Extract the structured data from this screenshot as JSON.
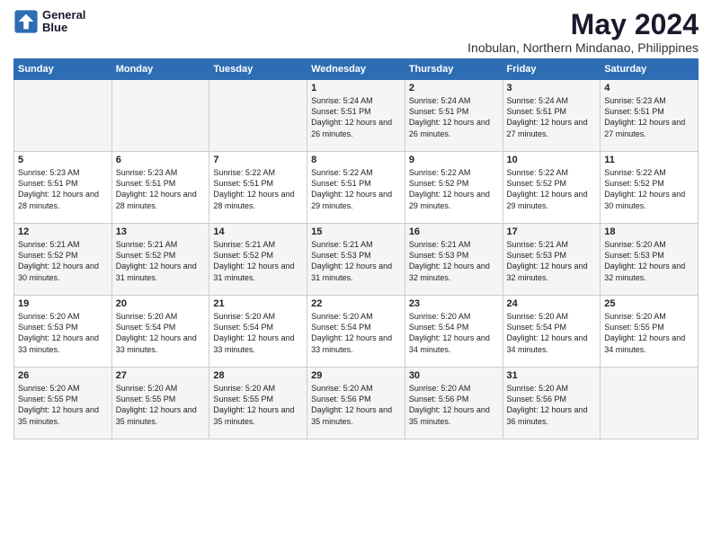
{
  "header": {
    "logo_line1": "General",
    "logo_line2": "Blue",
    "month_year": "May 2024",
    "location": "Inobulan, Northern Mindanao, Philippines"
  },
  "weekdays": [
    "Sunday",
    "Monday",
    "Tuesday",
    "Wednesday",
    "Thursday",
    "Friday",
    "Saturday"
  ],
  "weeks": [
    [
      {
        "day": "",
        "info": ""
      },
      {
        "day": "",
        "info": ""
      },
      {
        "day": "",
        "info": ""
      },
      {
        "day": "1",
        "info": "Sunrise: 5:24 AM\nSunset: 5:51 PM\nDaylight: 12 hours\nand 26 minutes."
      },
      {
        "day": "2",
        "info": "Sunrise: 5:24 AM\nSunset: 5:51 PM\nDaylight: 12 hours\nand 26 minutes."
      },
      {
        "day": "3",
        "info": "Sunrise: 5:24 AM\nSunset: 5:51 PM\nDaylight: 12 hours\nand 27 minutes."
      },
      {
        "day": "4",
        "info": "Sunrise: 5:23 AM\nSunset: 5:51 PM\nDaylight: 12 hours\nand 27 minutes."
      }
    ],
    [
      {
        "day": "5",
        "info": "Sunrise: 5:23 AM\nSunset: 5:51 PM\nDaylight: 12 hours\nand 28 minutes."
      },
      {
        "day": "6",
        "info": "Sunrise: 5:23 AM\nSunset: 5:51 PM\nDaylight: 12 hours\nand 28 minutes."
      },
      {
        "day": "7",
        "info": "Sunrise: 5:22 AM\nSunset: 5:51 PM\nDaylight: 12 hours\nand 28 minutes."
      },
      {
        "day": "8",
        "info": "Sunrise: 5:22 AM\nSunset: 5:51 PM\nDaylight: 12 hours\nand 29 minutes."
      },
      {
        "day": "9",
        "info": "Sunrise: 5:22 AM\nSunset: 5:52 PM\nDaylight: 12 hours\nand 29 minutes."
      },
      {
        "day": "10",
        "info": "Sunrise: 5:22 AM\nSunset: 5:52 PM\nDaylight: 12 hours\nand 29 minutes."
      },
      {
        "day": "11",
        "info": "Sunrise: 5:22 AM\nSunset: 5:52 PM\nDaylight: 12 hours\nand 30 minutes."
      }
    ],
    [
      {
        "day": "12",
        "info": "Sunrise: 5:21 AM\nSunset: 5:52 PM\nDaylight: 12 hours\nand 30 minutes."
      },
      {
        "day": "13",
        "info": "Sunrise: 5:21 AM\nSunset: 5:52 PM\nDaylight: 12 hours\nand 31 minutes."
      },
      {
        "day": "14",
        "info": "Sunrise: 5:21 AM\nSunset: 5:52 PM\nDaylight: 12 hours\nand 31 minutes."
      },
      {
        "day": "15",
        "info": "Sunrise: 5:21 AM\nSunset: 5:53 PM\nDaylight: 12 hours\nand 31 minutes."
      },
      {
        "day": "16",
        "info": "Sunrise: 5:21 AM\nSunset: 5:53 PM\nDaylight: 12 hours\nand 32 minutes."
      },
      {
        "day": "17",
        "info": "Sunrise: 5:21 AM\nSunset: 5:53 PM\nDaylight: 12 hours\nand 32 minutes."
      },
      {
        "day": "18",
        "info": "Sunrise: 5:20 AM\nSunset: 5:53 PM\nDaylight: 12 hours\nand 32 minutes."
      }
    ],
    [
      {
        "day": "19",
        "info": "Sunrise: 5:20 AM\nSunset: 5:53 PM\nDaylight: 12 hours\nand 33 minutes."
      },
      {
        "day": "20",
        "info": "Sunrise: 5:20 AM\nSunset: 5:54 PM\nDaylight: 12 hours\nand 33 minutes."
      },
      {
        "day": "21",
        "info": "Sunrise: 5:20 AM\nSunset: 5:54 PM\nDaylight: 12 hours\nand 33 minutes."
      },
      {
        "day": "22",
        "info": "Sunrise: 5:20 AM\nSunset: 5:54 PM\nDaylight: 12 hours\nand 33 minutes."
      },
      {
        "day": "23",
        "info": "Sunrise: 5:20 AM\nSunset: 5:54 PM\nDaylight: 12 hours\nand 34 minutes."
      },
      {
        "day": "24",
        "info": "Sunrise: 5:20 AM\nSunset: 5:54 PM\nDaylight: 12 hours\nand 34 minutes."
      },
      {
        "day": "25",
        "info": "Sunrise: 5:20 AM\nSunset: 5:55 PM\nDaylight: 12 hours\nand 34 minutes."
      }
    ],
    [
      {
        "day": "26",
        "info": "Sunrise: 5:20 AM\nSunset: 5:55 PM\nDaylight: 12 hours\nand 35 minutes."
      },
      {
        "day": "27",
        "info": "Sunrise: 5:20 AM\nSunset: 5:55 PM\nDaylight: 12 hours\nand 35 minutes."
      },
      {
        "day": "28",
        "info": "Sunrise: 5:20 AM\nSunset: 5:55 PM\nDaylight: 12 hours\nand 35 minutes."
      },
      {
        "day": "29",
        "info": "Sunrise: 5:20 AM\nSunset: 5:56 PM\nDaylight: 12 hours\nand 35 minutes."
      },
      {
        "day": "30",
        "info": "Sunrise: 5:20 AM\nSunset: 5:56 PM\nDaylight: 12 hours\nand 35 minutes."
      },
      {
        "day": "31",
        "info": "Sunrise: 5:20 AM\nSunset: 5:56 PM\nDaylight: 12 hours\nand 36 minutes."
      },
      {
        "day": "",
        "info": ""
      }
    ]
  ]
}
